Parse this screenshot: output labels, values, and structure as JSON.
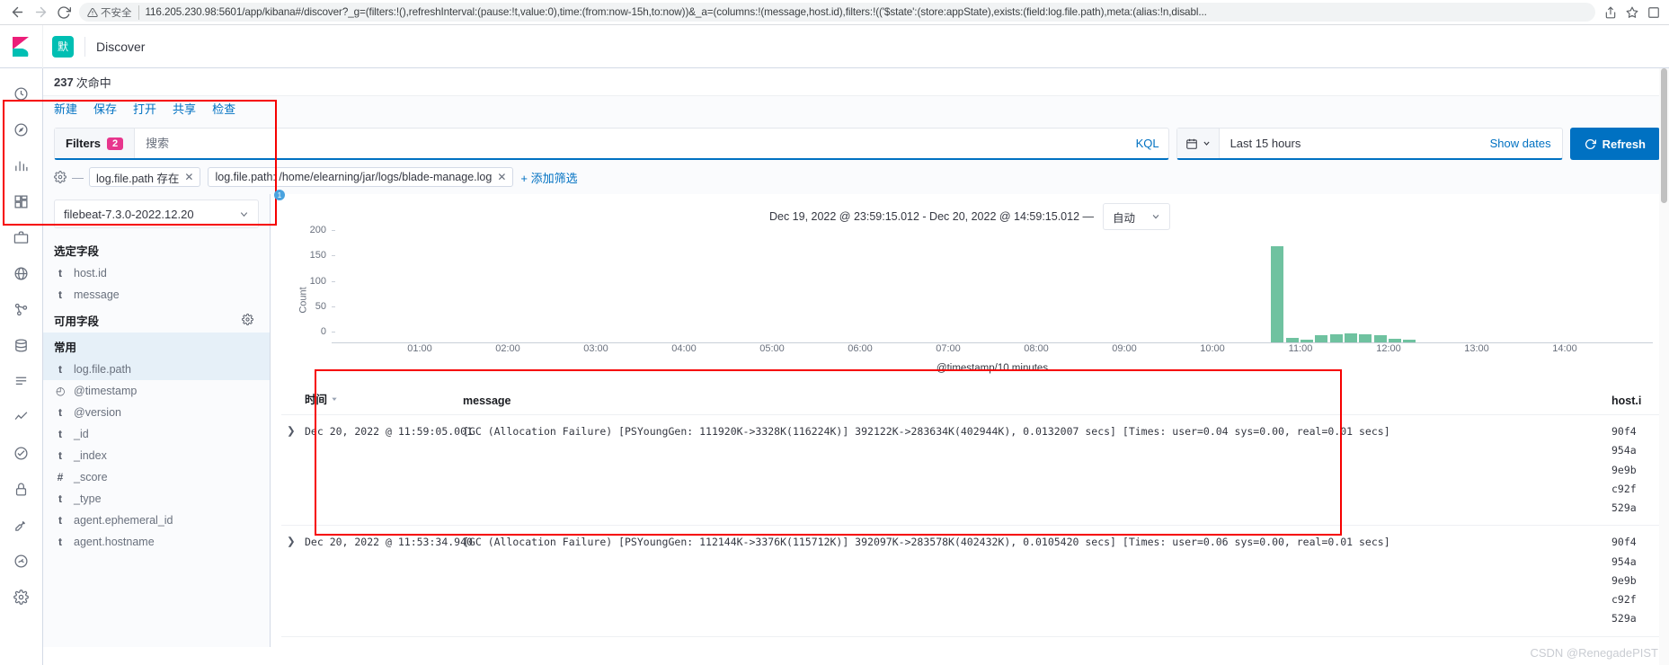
{
  "browser": {
    "back_icon": "arrow-left-icon",
    "forward_icon": "arrow-right-icon",
    "reload_icon": "reload-icon",
    "security_label": "不安全",
    "url": "116.205.230.98:5601/app/kibana#/discover?_g=(filters:!(),refreshInterval:(pause:!t,value:0),time:(from:now-15h,to:now))&_a=(columns:!(message,host.id),filters:!(('$state':(store:appState),exists:(field:log.file.path),meta:(alias:!n,disabl...",
    "share_icon": "share-icon",
    "bookmark_icon": "star-icon",
    "menu_icon": "extensions-icon"
  },
  "header": {
    "logo": "kibana-logo",
    "space_badge": "默",
    "app_title": "Discover"
  },
  "rail": {
    "items": [
      {
        "name": "recently-viewed-icon",
        "glyph": "clock"
      },
      {
        "name": "discover-icon",
        "glyph": "compass"
      },
      {
        "name": "visualize-icon",
        "glyph": "bar-chart"
      },
      {
        "name": "dashboard-icon",
        "glyph": "dashboard"
      },
      {
        "name": "canvas-icon",
        "glyph": "briefcase"
      },
      {
        "name": "maps-icon",
        "glyph": "globe"
      },
      {
        "name": "machine-learning-icon",
        "glyph": "ml"
      },
      {
        "name": "infrastructure-icon",
        "glyph": "infra"
      },
      {
        "name": "logs-icon",
        "glyph": "logs"
      },
      {
        "name": "apm-icon",
        "glyph": "apm"
      },
      {
        "name": "uptime-icon",
        "glyph": "uptime"
      },
      {
        "name": "siem-icon",
        "glyph": "lock"
      },
      {
        "name": "dev-tools-icon",
        "glyph": "wrench"
      },
      {
        "name": "monitoring-icon",
        "glyph": "monitor"
      },
      {
        "name": "management-icon",
        "glyph": "gear"
      }
    ]
  },
  "hits": {
    "count": "237",
    "label": "次命中"
  },
  "menu": {
    "items": [
      {
        "label": "新建",
        "name": "menu-new"
      },
      {
        "label": "保存",
        "name": "menu-save"
      },
      {
        "label": "打开",
        "name": "menu-open"
      },
      {
        "label": "共享",
        "name": "menu-share"
      },
      {
        "label": "检查",
        "name": "menu-inspect"
      }
    ]
  },
  "query_bar": {
    "filters_label": "Filters",
    "filters_count": "2",
    "search_placeholder": "搜索",
    "search_value": "",
    "language": "KQL",
    "calendar_icon": "calendar-icon",
    "time_range": "Last 15 hours",
    "show_dates": "Show dates",
    "refresh_label": "Refresh",
    "refresh_icon": "refresh-icon",
    "refresh_color": "#0071c2"
  },
  "filters": {
    "gear_icon": "filter-options-gear-icon",
    "pills": [
      {
        "label": "log.file.path 存在",
        "name": "filter-pill-exists"
      },
      {
        "label": "log.file.path: /home/elearning/jar/logs/blade-manage.log",
        "name": "filter-pill-path"
      }
    ],
    "add_filter": "+ 添加筛选"
  },
  "sidebar": {
    "index_pattern": "filebeat-7.3.0-2022.12.20",
    "chevron_icon": "chevron-down-icon",
    "selected_fields_title": "选定字段",
    "selected_fields": [
      {
        "type": "t",
        "name": "host.id"
      },
      {
        "type": "t",
        "name": "message"
      }
    ],
    "available_fields_title": "可用字段",
    "available_gear_icon": "field-settings-gear-icon",
    "popular_title": "常用",
    "popular_fields": [
      {
        "type": "t",
        "name": "log.file.path"
      }
    ],
    "other_fields": [
      {
        "type": "◴",
        "name": "@timestamp"
      },
      {
        "type": "t",
        "name": "@version"
      },
      {
        "type": "t",
        "name": "_id"
      },
      {
        "type": "t",
        "name": "_index"
      },
      {
        "type": "#",
        "name": "_score"
      },
      {
        "type": "t",
        "name": "_type"
      },
      {
        "type": "t",
        "name": "agent.ephemeral_id"
      },
      {
        "type": "t",
        "name": "agent.hostname"
      }
    ]
  },
  "chart_header": {
    "range": "Dec 19, 2022 @ 23:59:15.012 - Dec 20, 2022 @ 14:59:15.012 —",
    "interval_label": "自动",
    "interval_chevron": "chevron-down-icon"
  },
  "chart_data": {
    "type": "bar",
    "title": "",
    "xlabel": "@timestamp/10 minutes",
    "ylabel": "Count",
    "ylim": [
      0,
      200
    ],
    "yticks": [
      0,
      50,
      100,
      150,
      200
    ],
    "xticks": [
      "01:00",
      "02:00",
      "03:00",
      "04:00",
      "05:00",
      "06:00",
      "07:00",
      "08:00",
      "09:00",
      "10:00",
      "11:00",
      "12:00",
      "13:00",
      "14:00"
    ],
    "xlim": [
      "00:00",
      "15:00"
    ],
    "grid": false,
    "legend": "none",
    "bar_color": "#6fc2a0",
    "categories": [
      "10:40",
      "10:50",
      "11:00",
      "11:10",
      "11:20",
      "11:30",
      "11:40",
      "11:50",
      "12:00",
      "12:10"
    ],
    "values": [
      190,
      8,
      6,
      14,
      16,
      18,
      16,
      14,
      7,
      5
    ]
  },
  "doc_table": {
    "columns": [
      {
        "label": "时间",
        "name": "column-time",
        "sort_icon": "sort-desc-icon"
      },
      {
        "label": "message",
        "name": "column-message"
      },
      {
        "label": "host.i",
        "name": "column-host-id"
      }
    ],
    "rows": [
      {
        "expand_icon": "expand-row-icon",
        "time": "Dec 20, 2022 @ 11:59:05.001",
        "message": "[GC (Allocation Failure) [PSYoungGen: 111920K->3328K(116224K)] 392122K->283634K(402944K), 0.0132007 secs] [Times: user=0.04 sys=0.00, real=0.01 secs]",
        "host_id": "90f4\n954a\n9e9b\nc92f\n529a"
      },
      {
        "expand_icon": "expand-row-icon",
        "time": "Dec 20, 2022 @ 11:53:34.940",
        "message": "[GC (Allocation Failure) [PSYoungGen: 112144K->3376K(115712K)] 392097K->283578K(402432K), 0.0105420 secs] [Times: user=0.06 sys=0.00, real=0.01 secs]",
        "host_id": "90f4\n954a\n9e9b\nc92f\n529a"
      }
    ]
  },
  "annotations": {
    "badge_1": "1",
    "watermark": "CSDN @RenegadePIST"
  }
}
